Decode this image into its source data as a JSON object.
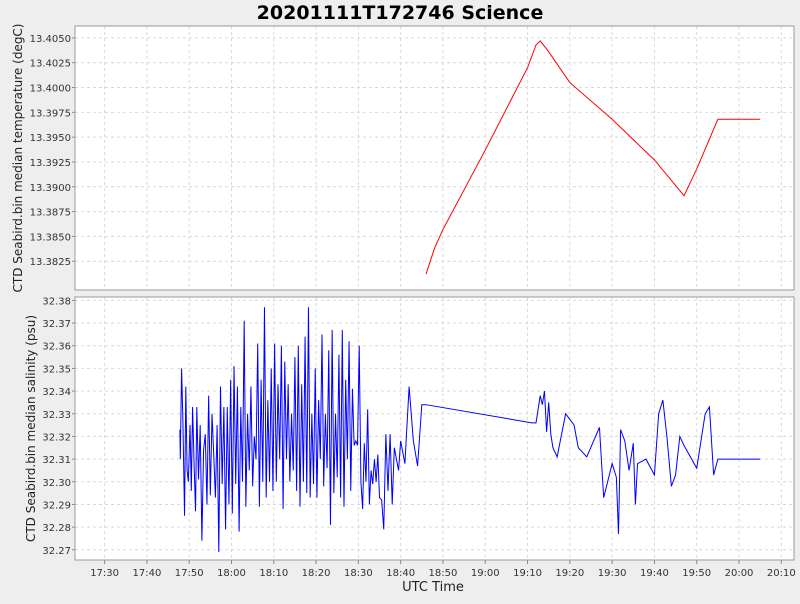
{
  "colors": {
    "background": "#eeeeee",
    "plot_background": "#ffffff",
    "grid": "#d9d9d9",
    "temperature_line": "#ff0000",
    "salinity_line": "#0000ff",
    "axis_text": "#333333"
  },
  "chart_data": {
    "type": "line",
    "title": "20201111T172746 Science",
    "xlabel": "UTC Time",
    "x_unit": "time",
    "xlim": [
      "17:23",
      "20:13"
    ],
    "x_ticks": [
      "17:30",
      "17:40",
      "17:50",
      "18:00",
      "18:10",
      "18:20",
      "18:30",
      "18:40",
      "18:50",
      "19:00",
      "19:10",
      "19:20",
      "19:30",
      "19:40",
      "19:50",
      "20:00",
      "20:10"
    ],
    "grid": true,
    "legend": "none",
    "panels": [
      {
        "ylabel": "CTD Seabird.bin median temperature (degC)",
        "ylim": [
          13.3796,
          13.4062
        ],
        "y_ticks": [
          "13.3825",
          "13.3850",
          "13.3875",
          "13.3900",
          "13.3925",
          "13.3950",
          "13.3975",
          "13.4000",
          "13.4025",
          "13.4050"
        ],
        "color": "#ff0000",
        "points": [
          [
            "18:46",
            13.3812
          ],
          [
            "18:48",
            13.3838
          ],
          [
            "18:50",
            13.3857
          ],
          [
            "19:00",
            13.3937
          ],
          [
            "19:10",
            13.402
          ],
          [
            "19:12",
            13.4043
          ],
          [
            "19:13",
            13.4047
          ],
          [
            "19:15",
            13.4036
          ],
          [
            "19:20",
            13.4005
          ],
          [
            "19:30",
            13.3968
          ],
          [
            "19:40",
            13.3927
          ],
          [
            "19:47",
            13.3891
          ],
          [
            "19:50",
            13.3918
          ],
          [
            "19:55",
            13.3968
          ],
          [
            "20:05",
            13.3968
          ]
        ]
      },
      {
        "ylabel": "CTD Seabird.bin median salinity (psu)",
        "ylim": [
          32.2655,
          32.3815
        ],
        "y_ticks": [
          "32.27",
          "32.28",
          "32.29",
          "32.30",
          "32.31",
          "32.32",
          "32.33",
          "32.34",
          "32.35",
          "32.36",
          "32.37",
          "32.38"
        ],
        "color": "#0000ff",
        "points": [
          [
            "17:47:48",
            32.323
          ],
          [
            "17:47:54",
            32.31
          ],
          [
            "17:48:12",
            32.35
          ],
          [
            "17:48:30",
            32.328
          ],
          [
            "17:48:54",
            32.285
          ],
          [
            "17:49:12",
            32.342
          ],
          [
            "17:49:30",
            32.305
          ],
          [
            "17:49:48",
            32.3
          ],
          [
            "17:50:12",
            32.325
          ],
          [
            "17:50:30",
            32.296
          ],
          [
            "17:50:48",
            32.333
          ],
          [
            "17:51:12",
            32.305
          ],
          [
            "17:51:30",
            32.287
          ],
          [
            "17:51:48",
            32.333
          ],
          [
            "17:52:12",
            32.301
          ],
          [
            "17:52:36",
            32.325
          ],
          [
            "17:53:00",
            32.274
          ],
          [
            "17:53:24",
            32.314
          ],
          [
            "17:53:48",
            32.321
          ],
          [
            "17:54:12",
            32.29
          ],
          [
            "17:54:36",
            32.338
          ],
          [
            "17:55:00",
            32.294
          ],
          [
            "17:55:24",
            32.33
          ],
          [
            "17:55:48",
            32.312
          ],
          [
            "17:56:12",
            32.293
          ],
          [
            "17:56:36",
            32.325
          ],
          [
            "17:57:00",
            32.269
          ],
          [
            "17:57:24",
            32.342
          ],
          [
            "17:57:48",
            32.299
          ],
          [
            "17:58:12",
            32.333
          ],
          [
            "17:58:36",
            32.279
          ],
          [
            "17:59:00",
            32.333
          ],
          [
            "17:59:24",
            32.29
          ],
          [
            "17:59:48",
            32.345
          ],
          [
            "18:00:12",
            32.286
          ],
          [
            "18:00:36",
            32.351
          ],
          [
            "18:01:00",
            32.299
          ],
          [
            "18:01:24",
            32.342
          ],
          [
            "18:01:48",
            32.278
          ],
          [
            "18:02:12",
            32.333
          ],
          [
            "18:02:36",
            32.3
          ],
          [
            "18:03:00",
            32.371
          ],
          [
            "18:03:24",
            32.289
          ],
          [
            "18:03:48",
            32.33
          ],
          [
            "18:04:12",
            32.305
          ],
          [
            "18:04:36",
            32.342
          ],
          [
            "18:05:00",
            32.298
          ],
          [
            "18:05:24",
            32.32
          ],
          [
            "18:05:48",
            32.31
          ],
          [
            "18:06:12",
            32.361
          ],
          [
            "18:06:36",
            32.289
          ],
          [
            "18:07:00",
            32.345
          ],
          [
            "18:07:24",
            32.3
          ],
          [
            "18:07:48",
            32.377
          ],
          [
            "18:08:12",
            32.293
          ],
          [
            "18:08:36",
            32.336
          ],
          [
            "18:09:00",
            32.3
          ],
          [
            "18:09:24",
            32.35
          ],
          [
            "18:09:48",
            32.296
          ],
          [
            "18:10:12",
            32.361
          ],
          [
            "18:10:36",
            32.3
          ],
          [
            "18:11:00",
            32.343
          ],
          [
            "18:11:24",
            32.31
          ],
          [
            "18:11:48",
            32.36
          ],
          [
            "18:12:12",
            32.288
          ],
          [
            "18:12:36",
            32.353
          ],
          [
            "18:13:00",
            32.31
          ],
          [
            "18:13:24",
            32.343
          ],
          [
            "18:13:48",
            32.3
          ],
          [
            "18:14:12",
            32.33
          ],
          [
            "18:14:36",
            32.305
          ],
          [
            "18:15:00",
            32.355
          ],
          [
            "18:15:24",
            32.296
          ],
          [
            "18:15:48",
            32.36
          ],
          [
            "18:16:12",
            32.289
          ],
          [
            "18:16:36",
            32.343
          ],
          [
            "18:17:00",
            32.3
          ],
          [
            "18:17:24",
            32.364
          ],
          [
            "18:17:48",
            32.295
          ],
          [
            "18:18:12",
            32.377
          ],
          [
            "18:18:36",
            32.293
          ],
          [
            "18:19:00",
            32.33
          ],
          [
            "18:19:24",
            32.299
          ],
          [
            "18:19:48",
            32.35
          ],
          [
            "18:20:12",
            32.293
          ],
          [
            "18:20:36",
            32.336
          ],
          [
            "18:21:00",
            32.31
          ],
          [
            "18:21:24",
            32.365
          ],
          [
            "18:21:48",
            32.298
          ],
          [
            "18:22:12",
            32.33
          ],
          [
            "18:22:36",
            32.306
          ],
          [
            "18:23:00",
            32.358
          ],
          [
            "18:23:24",
            32.281
          ],
          [
            "18:23:48",
            32.367
          ],
          [
            "18:24:12",
            32.295
          ],
          [
            "18:24:36",
            32.33
          ],
          [
            "18:25:00",
            32.302
          ],
          [
            "18:25:24",
            32.356
          ],
          [
            "18:25:48",
            32.293
          ],
          [
            "18:26:12",
            32.367
          ],
          [
            "18:26:36",
            32.289
          ],
          [
            "18:27:00",
            32.345
          ],
          [
            "18:27:24",
            32.31
          ],
          [
            "18:27:48",
            32.362
          ],
          [
            "18:28:12",
            32.296
          ],
          [
            "18:28:36",
            32.341
          ],
          [
            "18:29:00",
            32.316
          ],
          [
            "18:29:24",
            32.318
          ],
          [
            "18:29:48",
            32.316
          ],
          [
            "18:30:12",
            32.36
          ],
          [
            "18:30:36",
            32.3
          ],
          [
            "18:31:00",
            32.288
          ],
          [
            "18:31:24",
            32.317
          ],
          [
            "18:31:48",
            32.3
          ],
          [
            "18:32:12",
            32.332
          ],
          [
            "18:32:36",
            32.29
          ],
          [
            "18:33:00",
            32.305
          ],
          [
            "18:33:24",
            32.299
          ],
          [
            "18:33:48",
            32.31
          ],
          [
            "18:34:12",
            32.3
          ],
          [
            "18:34:36",
            32.312
          ],
          [
            "18:35:00",
            32.293
          ],
          [
            "18:35:30",
            32.292
          ],
          [
            "18:36:00",
            32.279
          ],
          [
            "18:36:30",
            32.321
          ],
          [
            "18:37:00",
            32.296
          ],
          [
            "18:37:30",
            32.321
          ],
          [
            "18:38:00",
            32.29
          ],
          [
            "18:38:30",
            32.315
          ],
          [
            "18:39:00",
            32.31
          ],
          [
            "18:39:30",
            32.305
          ],
          [
            "18:40:00",
            32.318
          ],
          [
            "18:41:00",
            32.308
          ],
          [
            "18:42:00",
            32.342
          ],
          [
            "18:43:00",
            32.318
          ],
          [
            "18:44:00",
            32.307
          ],
          [
            "18:45:00",
            32.334
          ],
          [
            "18:46:00",
            32.334
          ],
          [
            "19:11:00",
            32.326
          ],
          [
            "19:12:00",
            32.326
          ],
          [
            "19:13:00",
            32.338
          ],
          [
            "19:13:30",
            32.334
          ],
          [
            "19:14:00",
            32.34
          ],
          [
            "19:14:30",
            32.322
          ],
          [
            "19:15:00",
            32.335
          ],
          [
            "19:15:30",
            32.321
          ],
          [
            "19:16:00",
            32.315
          ],
          [
            "19:17:00",
            32.311
          ],
          [
            "19:19:00",
            32.33
          ],
          [
            "19:21:00",
            32.325
          ],
          [
            "19:22:00",
            32.315
          ],
          [
            "19:23:00",
            32.313
          ],
          [
            "19:24:00",
            32.311
          ],
          [
            "19:27:00",
            32.324
          ],
          [
            "19:28:00",
            32.293
          ],
          [
            "19:30:00",
            32.308
          ],
          [
            "19:31:00",
            32.302
          ],
          [
            "19:31:30",
            32.277
          ],
          [
            "19:32:00",
            32.323
          ],
          [
            "19:33:00",
            32.318
          ],
          [
            "19:34:00",
            32.305
          ],
          [
            "19:35:00",
            32.317
          ],
          [
            "19:35:30",
            32.29
          ],
          [
            "19:36:00",
            32.308
          ],
          [
            "19:38:00",
            32.31
          ],
          [
            "19:40:00",
            32.303
          ],
          [
            "19:41:00",
            32.33
          ],
          [
            "19:42:00",
            32.336
          ],
          [
            "19:43:00",
            32.319
          ],
          [
            "19:44:00",
            32.298
          ],
          [
            "19:45:00",
            32.303
          ],
          [
            "19:46:00",
            32.32
          ],
          [
            "19:47:00",
            32.316
          ],
          [
            "19:50:00",
            32.306
          ],
          [
            "19:52:00",
            32.33
          ],
          [
            "19:53:00",
            32.333
          ],
          [
            "19:54:00",
            32.303
          ],
          [
            "19:55:00",
            32.31
          ],
          [
            "20:05:00",
            32.31
          ]
        ]
      }
    ]
  }
}
